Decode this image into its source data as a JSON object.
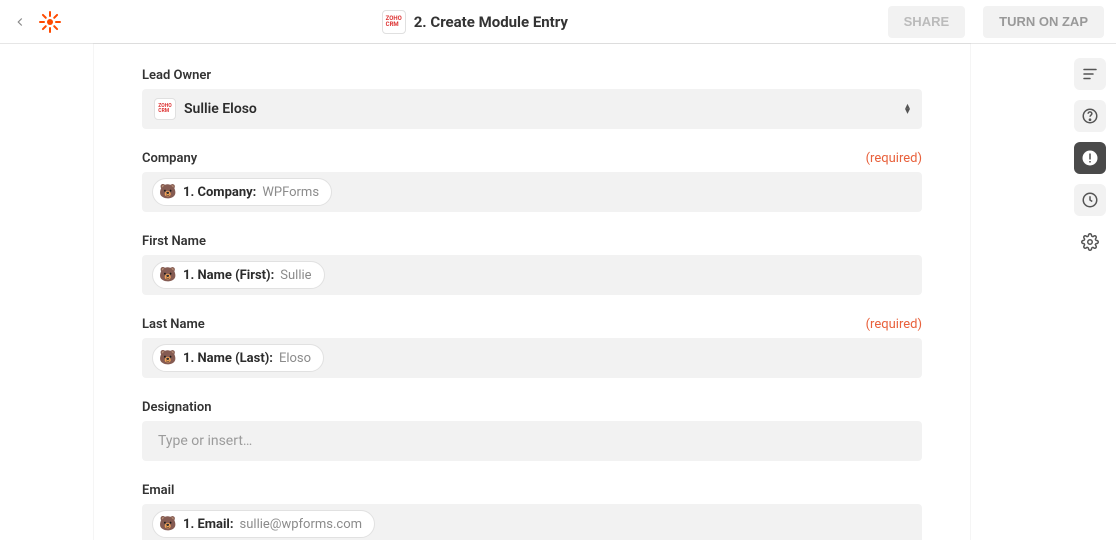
{
  "header": {
    "title": "2. Create Module Entry",
    "share_label": "SHARE",
    "turn_on_label": "TURN ON ZAP"
  },
  "fields": {
    "lead_owner": {
      "label": "Lead Owner",
      "value": "Sullie Eloso"
    },
    "company": {
      "label": "Company",
      "required_text": "(required)",
      "pill_label": "1. Company:",
      "pill_value": "WPForms"
    },
    "first_name": {
      "label": "First Name",
      "pill_label": "1. Name (First):",
      "pill_value": "Sullie"
    },
    "last_name": {
      "label": "Last Name",
      "required_text": "(required)",
      "pill_label": "1. Name (Last):",
      "pill_value": "Eloso"
    },
    "designation": {
      "label": "Designation",
      "placeholder": "Type or insert…"
    },
    "email": {
      "label": "Email",
      "pill_label": "1. Email:",
      "pill_value": "sullie@wpforms.com"
    }
  }
}
